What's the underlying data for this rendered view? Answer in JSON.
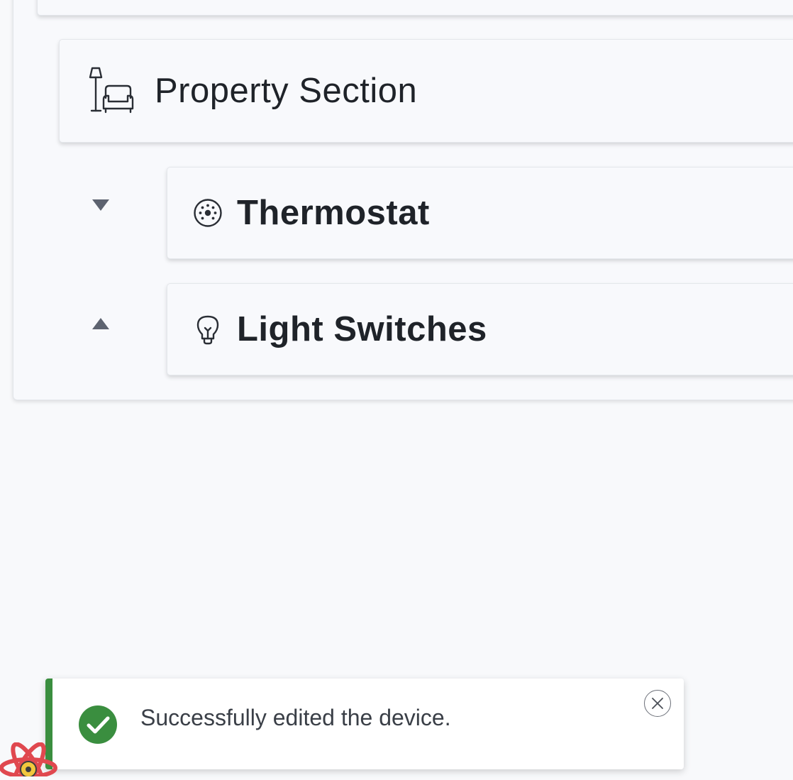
{
  "tree": {
    "section": {
      "title": "Property Section",
      "icon": "lamp-sofa-icon"
    },
    "devices": [
      {
        "title": "Thermostat",
        "icon": "thermostat-icon",
        "move_control": "move-down-arrow"
      },
      {
        "title": "Light Switches",
        "icon": "lightbulb-icon",
        "move_control": "move-up-arrow"
      }
    ]
  },
  "toast": {
    "message": "Successfully edited the device.",
    "status": "success",
    "icon": "check-circle-icon",
    "close_icon": "close-icon",
    "accent_color": "#3a8e3f"
  },
  "colors": {
    "background": "#f8f9fb",
    "card": "#f8f9fc",
    "text": "#1f2329",
    "arrow": "#5d6370"
  }
}
